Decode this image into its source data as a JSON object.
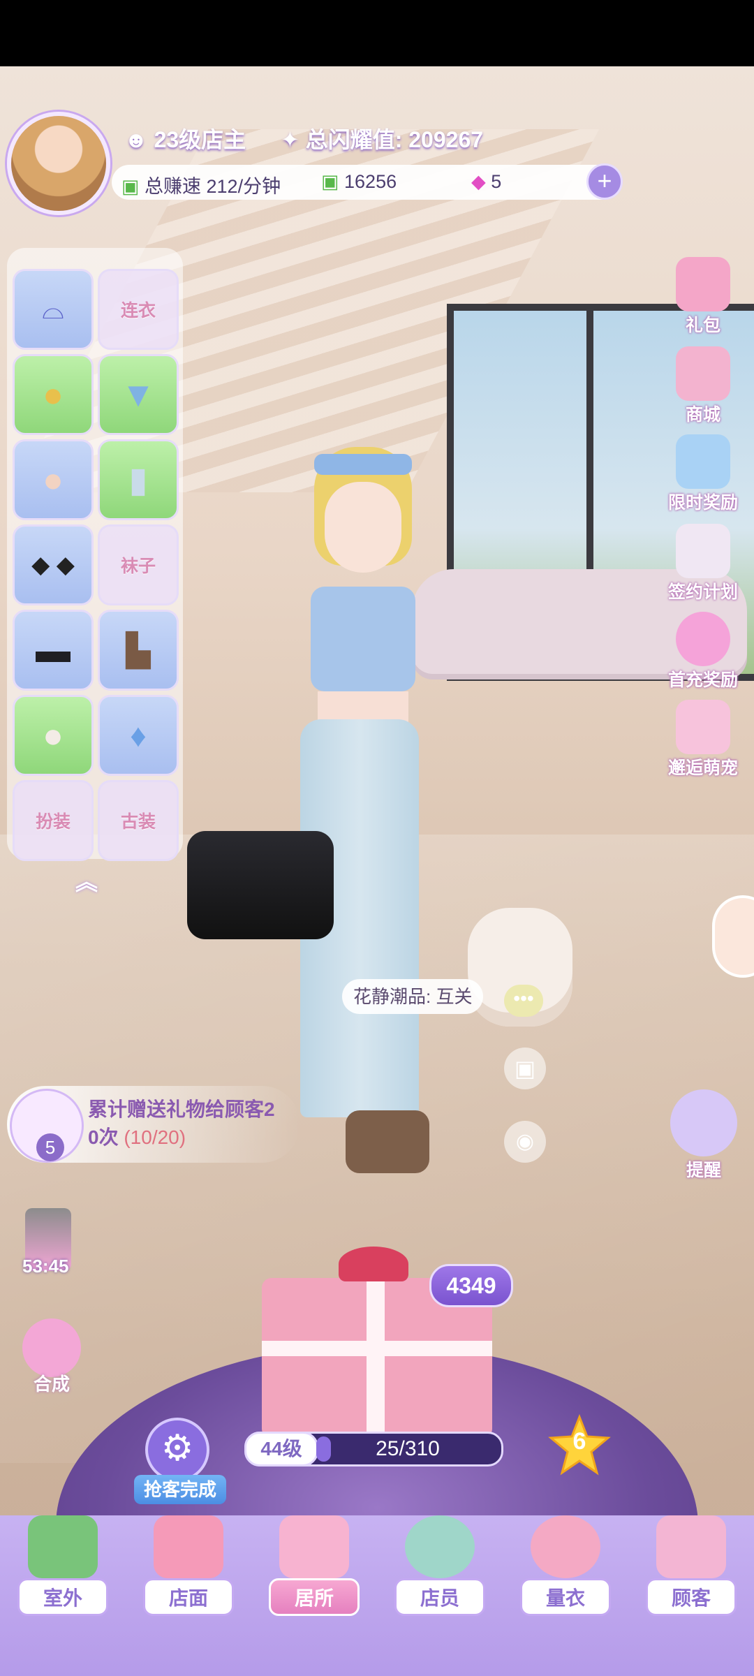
{
  "header": {
    "level_text": "23级店主",
    "shine_label": "总闪耀值: 209267",
    "earn_rate": "总赚速 212/分钟",
    "cash": "16256",
    "gems": "5",
    "plus_icon": "plus-icon"
  },
  "wardrobe": {
    "slots": [
      {
        "label": "",
        "icon": "sunglasses-icon"
      },
      {
        "label": "连衣",
        "icon": "dress-icon"
      },
      {
        "label": "",
        "icon": "hair-icon"
      },
      {
        "label": "",
        "icon": "top-icon"
      },
      {
        "label": "",
        "icon": "face-icon"
      },
      {
        "label": "",
        "icon": "pants-icon"
      },
      {
        "label": "",
        "icon": "earrings-icon"
      },
      {
        "label": "袜子",
        "icon": "socks-icon"
      },
      {
        "label": "",
        "icon": "handbag-icon"
      },
      {
        "label": "",
        "icon": "shoes-icon"
      },
      {
        "label": "",
        "icon": "hamster-pet-icon"
      },
      {
        "label": "",
        "icon": "perfume-icon"
      },
      {
        "label": "扮装",
        "icon": "mask-icon"
      },
      {
        "label": "古装",
        "icon": "hanfu-icon"
      }
    ]
  },
  "right_menu": [
    {
      "label": "礼包",
      "icon": "gift-pack-icon"
    },
    {
      "label": "商城",
      "icon": "shop-icon"
    },
    {
      "label": "限时奖励",
      "icon": "limited-reward-icon"
    },
    {
      "label": "签约计划",
      "icon": "contract-icon"
    },
    {
      "label": "首充奖励",
      "icon": "first-recharge-icon"
    },
    {
      "label": "邂逅萌宠",
      "icon": "pet-house-icon"
    },
    {
      "label": "提醒",
      "icon": "reminder-icon"
    }
  ],
  "scene": {
    "speech_bubble": "花静潮品: 互关",
    "timer": "53:45",
    "synth_label": "合成"
  },
  "task": {
    "line1": "累计赠送礼物给顾客2",
    "line2_prefix": "0次",
    "progress": "(10/20)",
    "badge": "5"
  },
  "gift": {
    "count": "4349",
    "level": "44级",
    "exp": "25/310",
    "star_count": "6",
    "auto_label": "抢客完成"
  },
  "nav": [
    {
      "label": "室外",
      "icon": "palm-tree-icon",
      "active": false
    },
    {
      "label": "店面",
      "icon": "storefront-icon",
      "active": false
    },
    {
      "label": "居所",
      "icon": "house-icon",
      "active": true
    },
    {
      "label": "店员",
      "icon": "staff-icon",
      "active": false
    },
    {
      "label": "量衣",
      "icon": "tape-measure-icon",
      "active": false
    },
    {
      "label": "顾客",
      "icon": "shopping-bag-icon",
      "active": false
    }
  ]
}
